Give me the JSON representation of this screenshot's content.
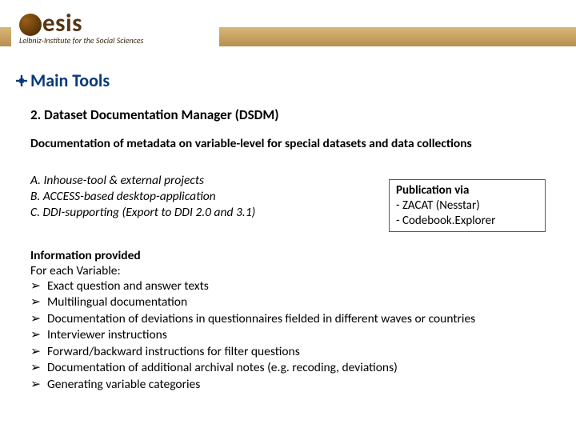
{
  "logo": {
    "word": "esis",
    "sub": "Leibniz-Institute for the Social Sciences"
  },
  "title": "Main Tools",
  "subtitle": "2. Dataset Documentation Manager (DSDM)",
  "desc": "Documentation of metadata on variable-level for special datasets and data collections",
  "abc": {
    "a": "A. Inhouse-tool & external projects",
    "b": "B. ACCESS-based desktop-application",
    "c": "C. DDI-supporting (Export to DDI 2.0 and 3.1)"
  },
  "pub": {
    "hdr": "Publication via",
    "l1": "- ZACAT (Nesstar)",
    "l2": "- Codebook.Explorer"
  },
  "info": {
    "hdr": "Information provided",
    "each": "For each Variable:"
  },
  "items": [
    "Exact question and answer texts",
    "Multilingual documentation",
    "Documentation of deviations in questionnaires fielded in different waves or countries",
    "Interviewer instructions",
    "Forward/backward instructions for filter questions",
    "Documentation of additional archival notes (e.g. recoding, deviations)",
    "Generating variable categories"
  ]
}
